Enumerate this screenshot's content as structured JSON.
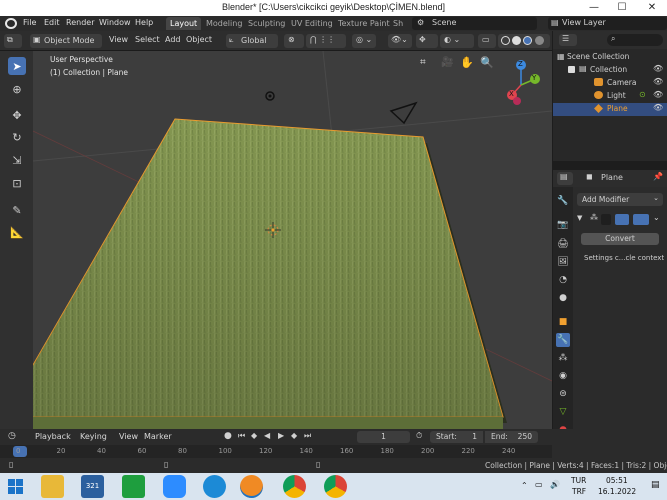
{
  "window": {
    "title": "Blender* [C:\\Users\\cikcikci geyik\\Desktop\\ÇİMEN.blend]",
    "minimize": "—",
    "maximize": "☐",
    "close": "✕"
  },
  "menu": [
    "File",
    "Edit",
    "Render",
    "Window",
    "Help"
  ],
  "workspaces": [
    "Layout",
    "Modeling",
    "Sculpting",
    "UV Editing",
    "Texture Paint",
    "Sh"
  ],
  "scene": {
    "label": "Scene",
    "view_layer": "View Layer"
  },
  "viewport_header": {
    "mode": "Object Mode",
    "menus": [
      "View",
      "Select",
      "Add",
      "Object"
    ],
    "transform": "Global"
  },
  "viewport": {
    "perspective": "User Perspective",
    "collection_info": "(1) Collection | Plane",
    "gizmo_x": "X",
    "gizmo_y": "Y",
    "gizmo_z": "Z"
  },
  "outliner": {
    "root": "Scene Collection",
    "items": [
      {
        "label": "Collection",
        "icon": "collection-icon"
      },
      {
        "label": "Camera",
        "icon": "camera-icon"
      },
      {
        "label": "Light",
        "icon": "light-icon"
      },
      {
        "label": "Plane",
        "icon": "mesh-icon"
      }
    ]
  },
  "properties": {
    "object_name": "Plane",
    "add_modifier": "Add Modifier",
    "convert": "Convert",
    "settings_text": "Settings c...cle context"
  },
  "timeline": {
    "menus": [
      "Playback",
      "Keying",
      "View",
      "Marker"
    ],
    "current_frame": "1",
    "start_label": "Start:",
    "start": "1",
    "end_label": "End:",
    "end": "250",
    "ticks": [
      "0",
      "20",
      "40",
      "60",
      "80",
      "100",
      "120",
      "140",
      "160",
      "180",
      "200",
      "220",
      "240"
    ]
  },
  "status": {
    "text": "Collection | Plane | Verts:4 | Faces:1 | Tris:2 | Objects:1/"
  },
  "taskbar": {
    "lang": "TUR",
    "lang2": "TRF",
    "time": "05:51",
    "date": "16.1.2022",
    "badge": "321"
  },
  "colors": {
    "accent": "#4772b3",
    "grass": "#8a9e55",
    "selected_orange": "#f0a030",
    "x_axis": "#e0444f",
    "y_axis": "#76b82a",
    "z_axis": "#3c8ae0"
  }
}
